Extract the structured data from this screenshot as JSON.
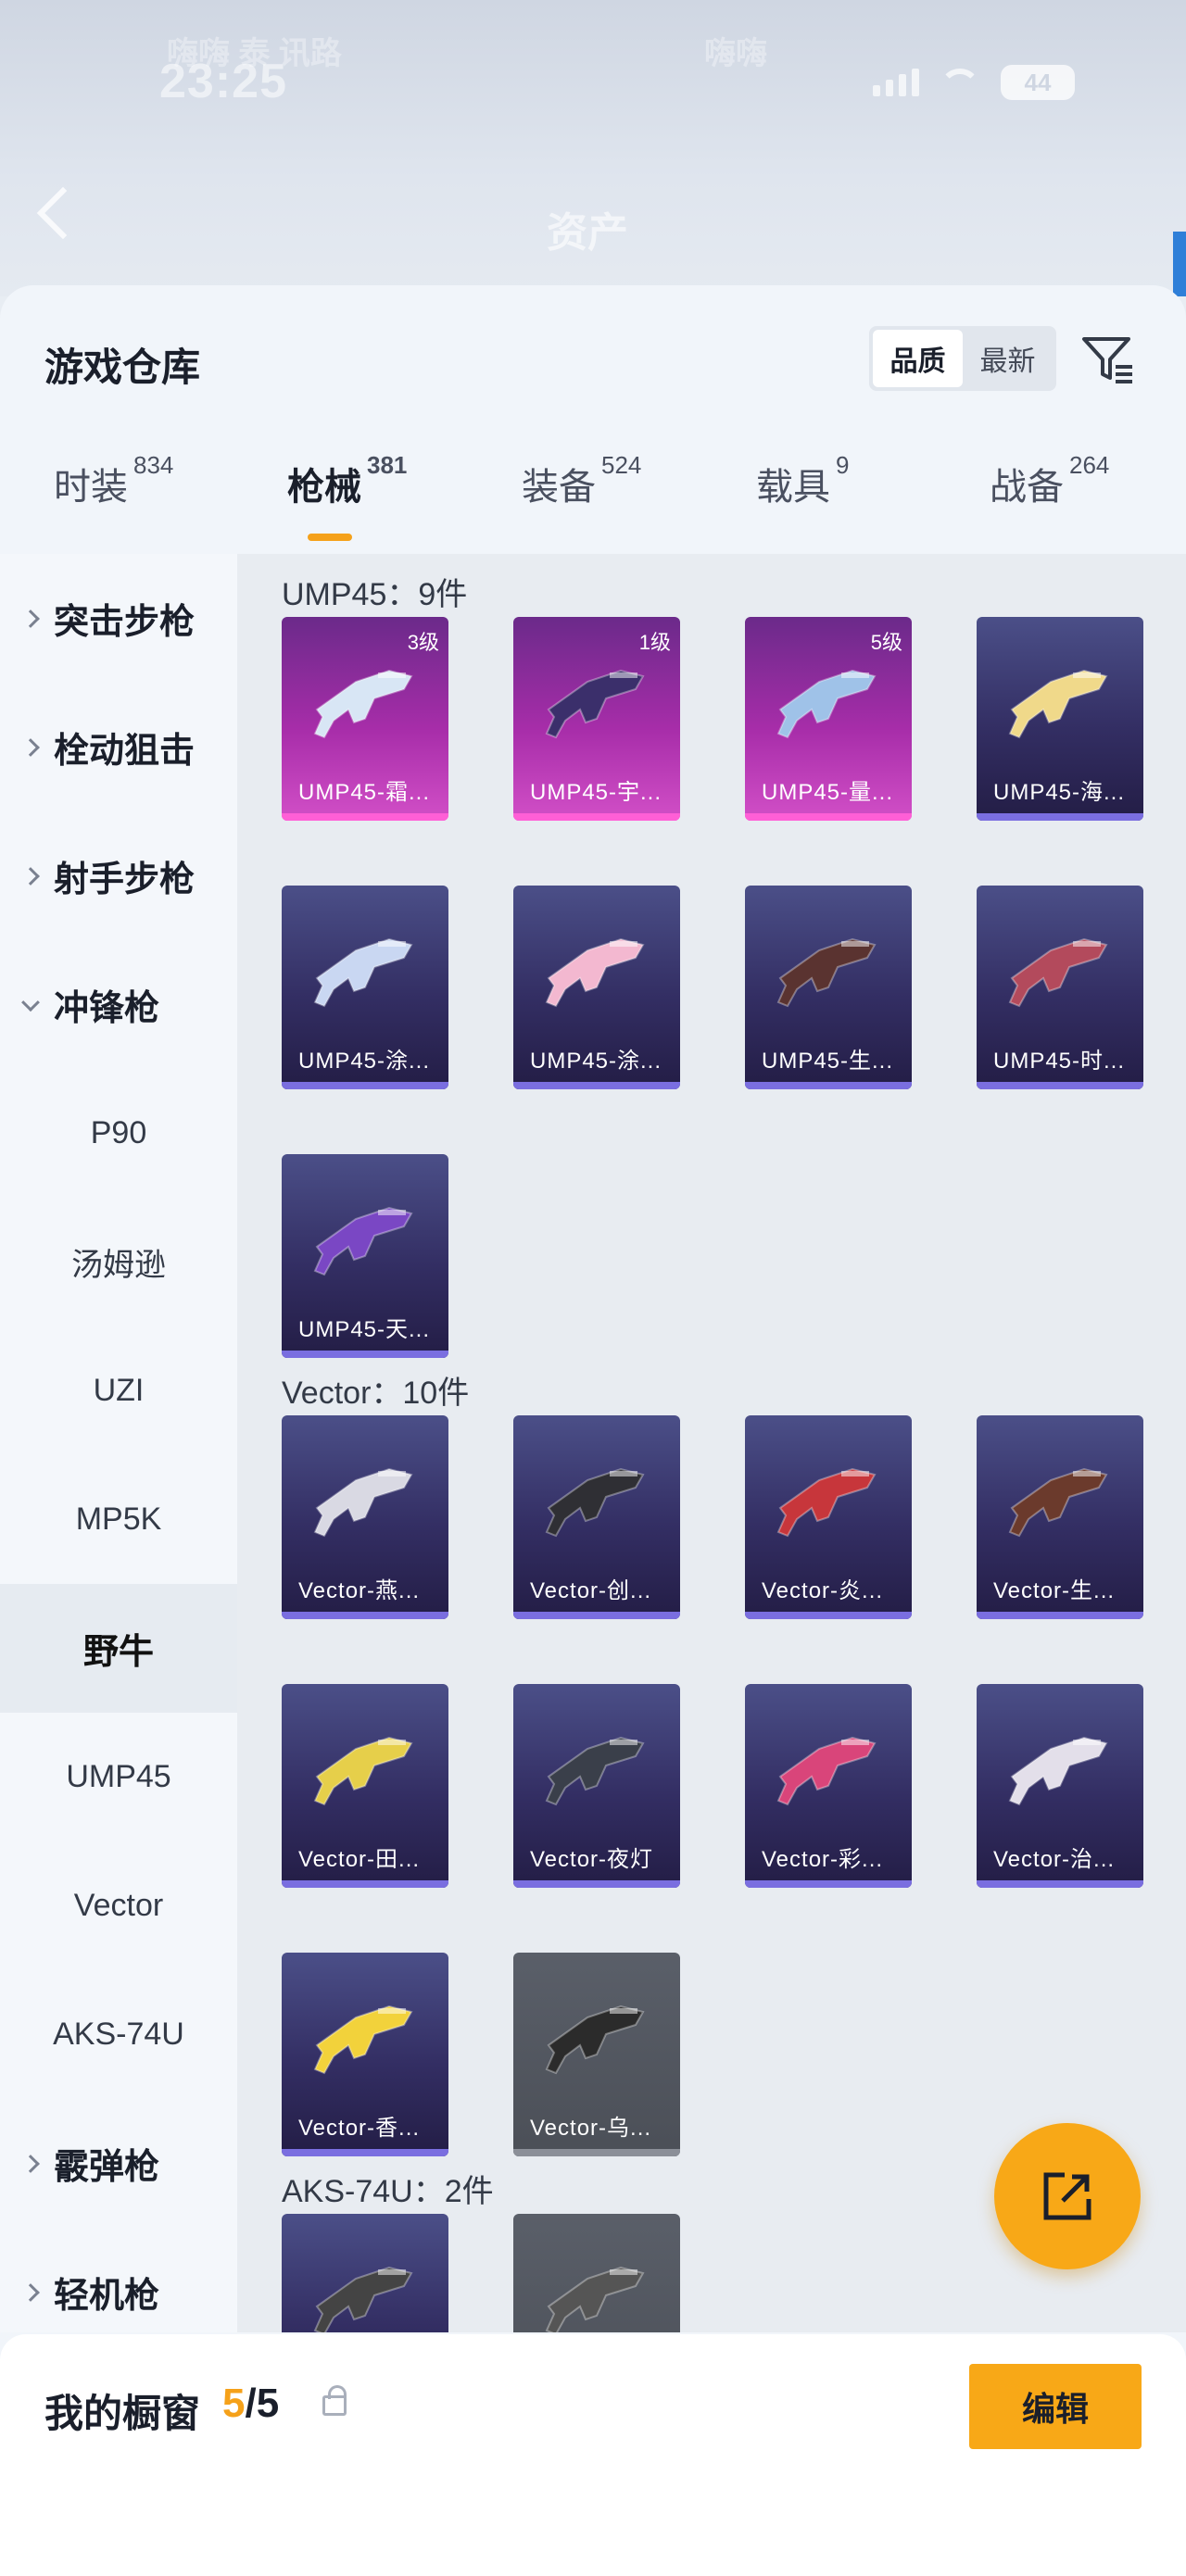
{
  "status": {
    "time": "23:25",
    "battery": "44",
    "blurred_left": "嗨嗨 泰 讯路",
    "blurred_right": "嗨嗨"
  },
  "header": {
    "title": "资产"
  },
  "sheet": {
    "title": "游戏仓库",
    "sort": {
      "options": [
        "品质",
        "最新"
      ],
      "active": "品质"
    }
  },
  "tabs": [
    {
      "label": "时装",
      "count": "834"
    },
    {
      "label": "枪械",
      "count": "381"
    },
    {
      "label": "装备",
      "count": "524"
    },
    {
      "label": "载具",
      "count": "9"
    },
    {
      "label": "战备",
      "count": "264"
    }
  ],
  "sidebar": [
    {
      "label": "突击步枪",
      "type": "group"
    },
    {
      "label": "栓动狙击",
      "type": "group"
    },
    {
      "label": "射手步枪",
      "type": "group"
    },
    {
      "label": "冲锋枪",
      "type": "group-open"
    },
    {
      "label": "P90",
      "type": "sub"
    },
    {
      "label": "汤姆逊",
      "type": "sub"
    },
    {
      "label": "UZI",
      "type": "sub"
    },
    {
      "label": "MP5K",
      "type": "sub"
    },
    {
      "label": "野牛",
      "type": "selected"
    },
    {
      "label": "UMP45",
      "type": "sub"
    },
    {
      "label": "Vector",
      "type": "sub"
    },
    {
      "label": "AKS-74U",
      "type": "sub"
    },
    {
      "label": "霰弹枪",
      "type": "group"
    },
    {
      "label": "轻机枪",
      "type": "group"
    }
  ],
  "sections": [
    {
      "title": "UMP45：9件",
      "items": [
        {
          "name": "UMP45-霜...",
          "level": "3级",
          "rarity": "pink"
        },
        {
          "name": "UMP45-宇...",
          "level": "1级",
          "rarity": "pink"
        },
        {
          "name": "UMP45-量...",
          "level": "5级",
          "rarity": "pink"
        },
        {
          "name": "UMP45-海...",
          "level": "",
          "rarity": "purple"
        },
        {
          "name": "UMP45-涂...",
          "level": "",
          "rarity": "purple"
        },
        {
          "name": "UMP45-涂...",
          "level": "",
          "rarity": "purple"
        },
        {
          "name": "UMP45-生...",
          "level": "",
          "rarity": "purple"
        },
        {
          "name": "UMP45-时...",
          "level": "",
          "rarity": "purple"
        },
        {
          "name": "UMP45-天...",
          "level": "",
          "rarity": "purple"
        }
      ]
    },
    {
      "title": "Vector：10件",
      "items": [
        {
          "name": "Vector-燕...",
          "level": "",
          "rarity": "purple"
        },
        {
          "name": "Vector-创...",
          "level": "",
          "rarity": "purple"
        },
        {
          "name": "Vector-炎...",
          "level": "",
          "rarity": "purple"
        },
        {
          "name": "Vector-生...",
          "level": "",
          "rarity": "purple"
        },
        {
          "name": "Vector-田...",
          "level": "",
          "rarity": "purple"
        },
        {
          "name": "Vector-夜灯",
          "level": "",
          "rarity": "purple"
        },
        {
          "name": "Vector-彩...",
          "level": "",
          "rarity": "purple"
        },
        {
          "name": "Vector-治...",
          "level": "",
          "rarity": "purple"
        },
        {
          "name": "Vector-香...",
          "level": "",
          "rarity": "purple"
        },
        {
          "name": "Vector-乌...",
          "level": "",
          "rarity": "gray"
        }
      ]
    },
    {
      "title": "AKS-74U：2件",
      "items": [
        {
          "name": "",
          "level": "",
          "rarity": "purple"
        },
        {
          "name": "",
          "level": "",
          "rarity": "gray"
        }
      ]
    }
  ],
  "showcase": {
    "title": "我的橱窗",
    "current": "5",
    "total": "/5",
    "edit_label": "编辑"
  },
  "colors": {
    "accent": "#f8a817",
    "rarity_pink": "#d24fc7",
    "rarity_purple": "#4b4f88",
    "rarity_gray": "#5a5f69"
  }
}
